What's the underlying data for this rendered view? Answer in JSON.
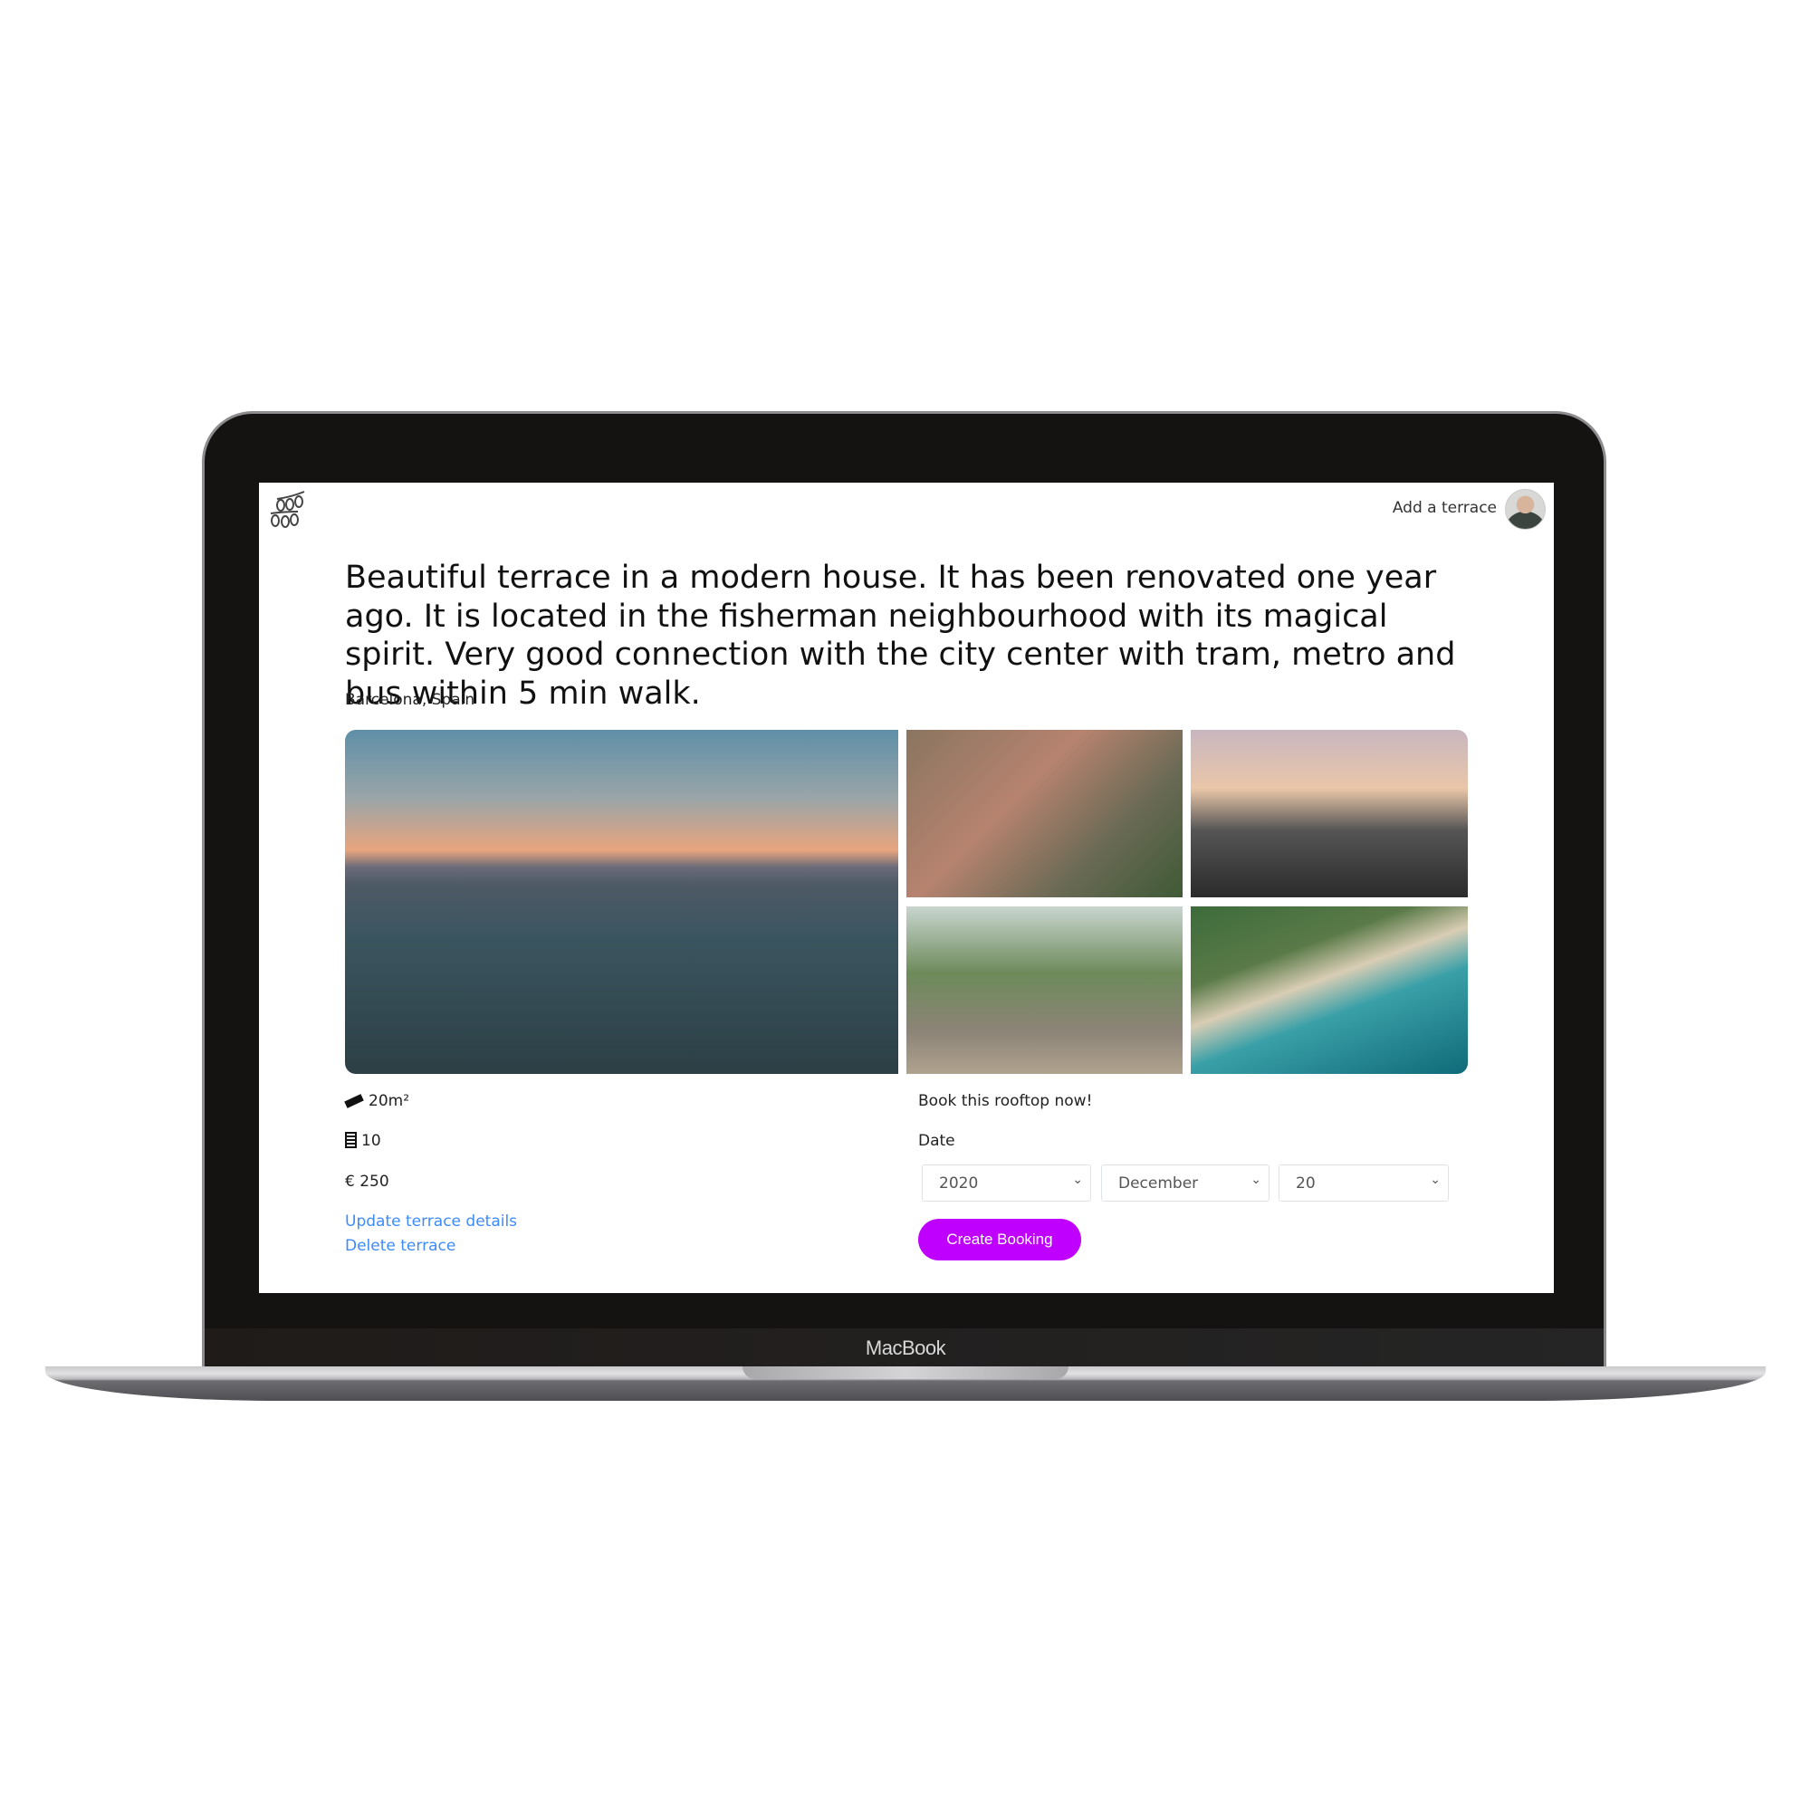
{
  "device": {
    "brand_label": "MacBook"
  },
  "navbar": {
    "logo_icon": "string-lights-icon",
    "add_terrace_label": "Add a terrace",
    "avatar_icon": "user-avatar"
  },
  "listing": {
    "description": "Beautiful terrace in a modern house. It has been renovated one year ago. It is located in the fisherman neighbourhood with its magical spirit. Very good connection with the city center with tram, metro and bus within 5 min walk.",
    "location": "Barcelona, Spain",
    "photos": [
      "harbour-sunset",
      "city-rooftops",
      "terrace-sunset",
      "garden-terrace",
      "beach-aerial"
    ],
    "size": "20m²",
    "size_icon": "ruler-icon",
    "floor": "10",
    "floor_icon": "building-icon",
    "price": "€ 250",
    "update_link": "Update terrace details",
    "delete_link": "Delete terrace"
  },
  "booking": {
    "heading": "Book this rooftop now!",
    "date_label": "Date",
    "year": "2020",
    "month": "December",
    "day": "20",
    "submit_label": "Create Booking",
    "accent_color": "#c000ff",
    "link_color": "#3d8bfd"
  }
}
